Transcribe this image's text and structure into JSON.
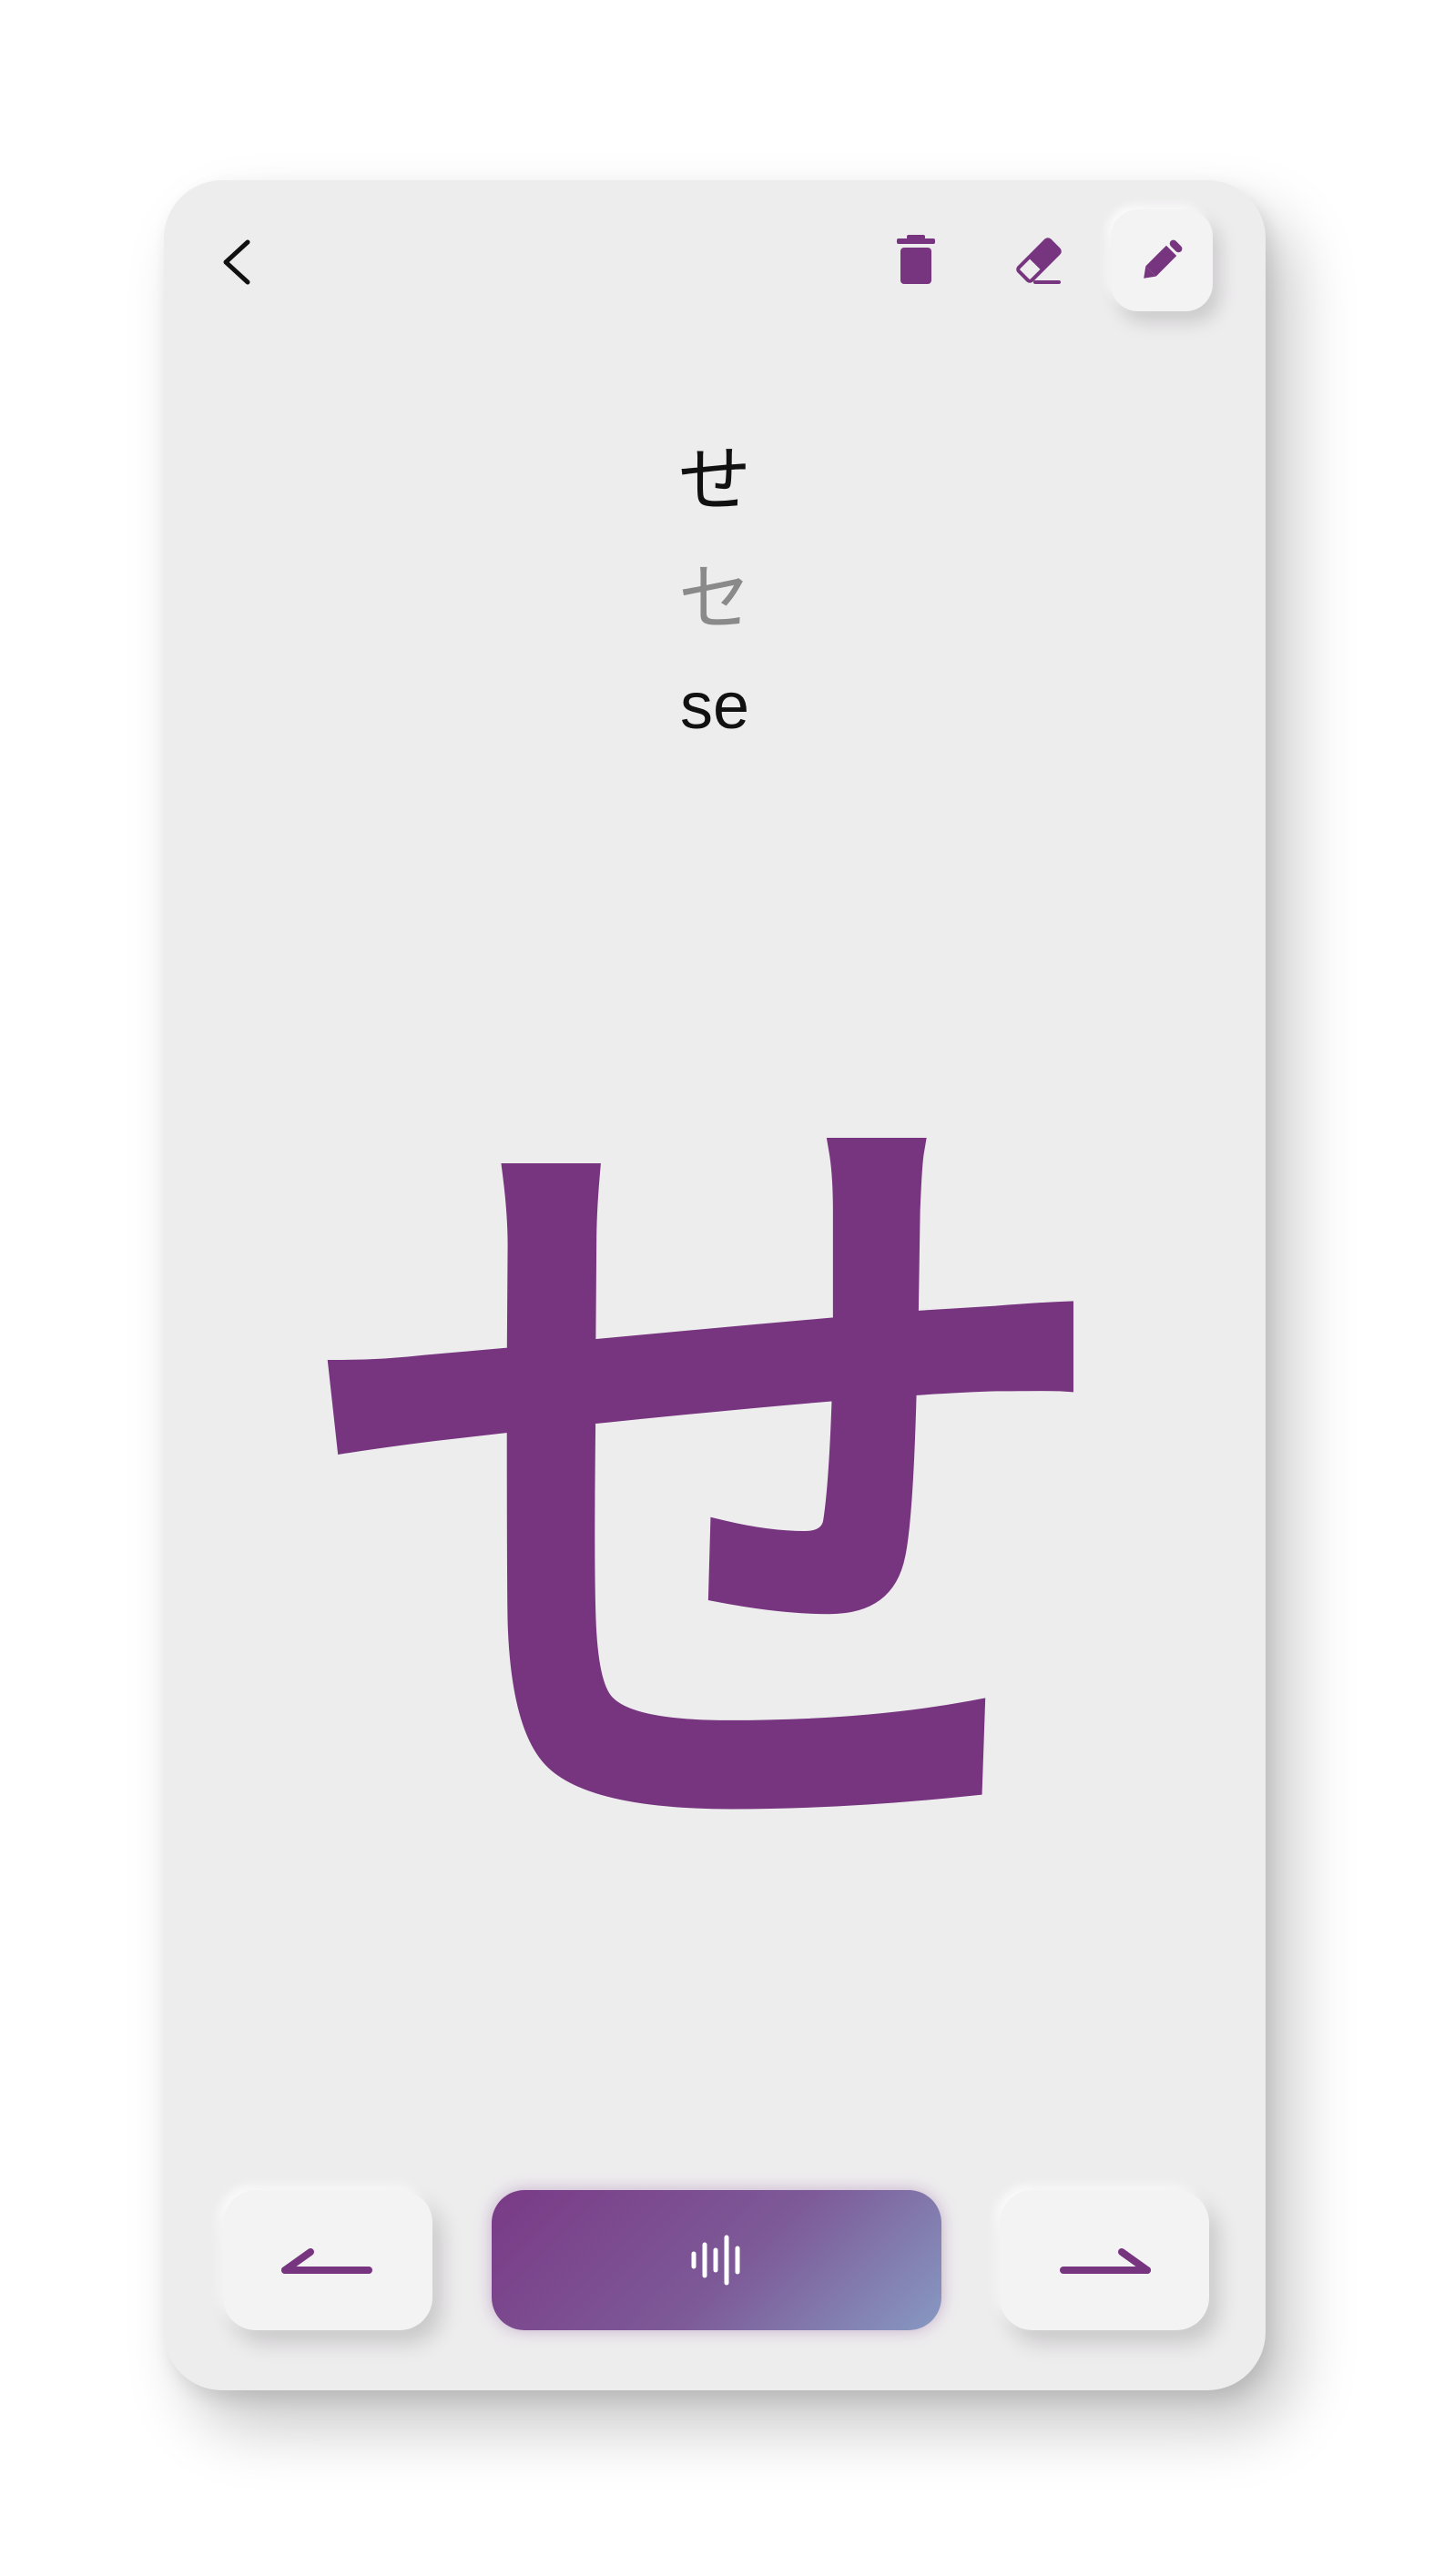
{
  "card": {
    "hiragana": "せ",
    "katakana": "セ",
    "romaji": "se",
    "glyph": "せ"
  },
  "toolbar": {
    "back_icon": "chevron-left-icon",
    "delete_icon": "trash-icon",
    "erase_icon": "eraser-icon",
    "pen_icon": "pencil-icon",
    "active_tool": "pen"
  },
  "footer": {
    "prev_icon": "arrow-left-icon",
    "audio_icon": "waveform-icon",
    "next_icon": "arrow-right-icon"
  },
  "colors": {
    "accent": "#773580",
    "background": "#eeedee",
    "audio_gradient_start": "#7a3a86",
    "audio_gradient_end": "#8799c2"
  }
}
